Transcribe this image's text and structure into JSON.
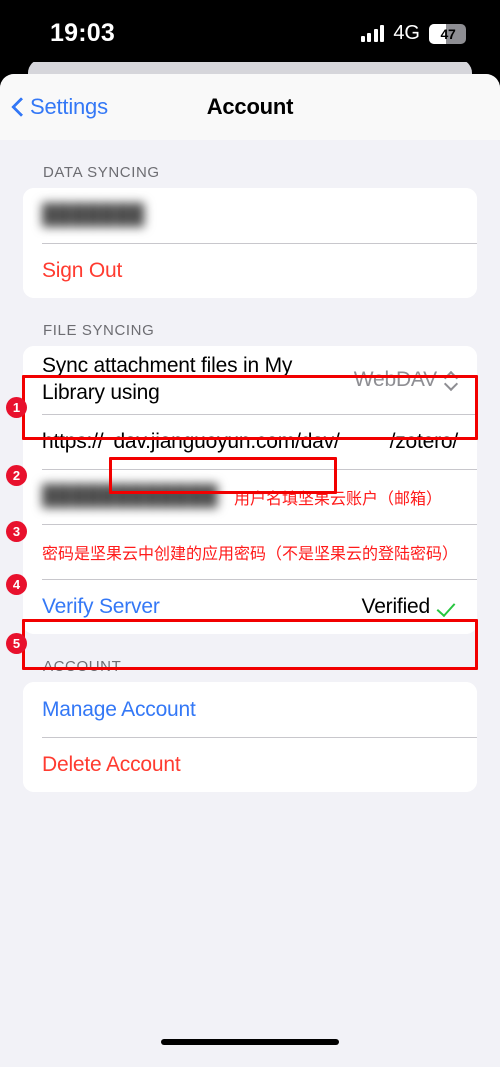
{
  "status_bar": {
    "time": "19:03",
    "network_type": "4G",
    "battery_level": "47",
    "battery_percent": 47,
    "signal_icon": "signal-bars-icon",
    "battery_icon": "battery-icon"
  },
  "nav": {
    "back_label": "Settings",
    "back_icon": "chevron-left-icon",
    "title": "Account"
  },
  "sections": {
    "data_syncing": {
      "header": "DATA SYNCING",
      "username_redacted": "███████",
      "sign_out": "Sign Out"
    },
    "file_syncing": {
      "header": "FILE SYNCING",
      "sync_row": {
        "label": "Sync attachment files in My Library using",
        "value": "WebDAV",
        "picker_icon": "up-down-chevron-icon"
      },
      "url_row": {
        "scheme": "https://",
        "host": "dav.jianguoyun.com/dav/",
        "path": "/zotero/"
      },
      "username_row": {
        "value_redacted": "████████████",
        "annotation": "用户名填坚果云账户（邮箱）"
      },
      "password_row": {
        "annotation": "密码是坚果云中创建的应用密码（不是坚果云的登陆密码）"
      },
      "verify_row": {
        "label": "Verify Server",
        "status": "Verified",
        "status_icon": "green-check-icon"
      }
    },
    "account": {
      "header": "ACCOUNT",
      "manage": "Manage Account",
      "delete": "Delete Account"
    }
  },
  "annotations": {
    "markers": [
      {
        "number": "1"
      },
      {
        "number": "2"
      },
      {
        "number": "3"
      },
      {
        "number": "4"
      },
      {
        "number": "5"
      }
    ]
  },
  "colors": {
    "accent_blue": "#3478f6",
    "destructive_red": "#ff3b30",
    "annotation_red": "#f20000",
    "marker_red": "#e8112d",
    "success_green": "#27c53f",
    "grey_text": "#8e8e93",
    "page_bg": "#f2f2f7"
  }
}
